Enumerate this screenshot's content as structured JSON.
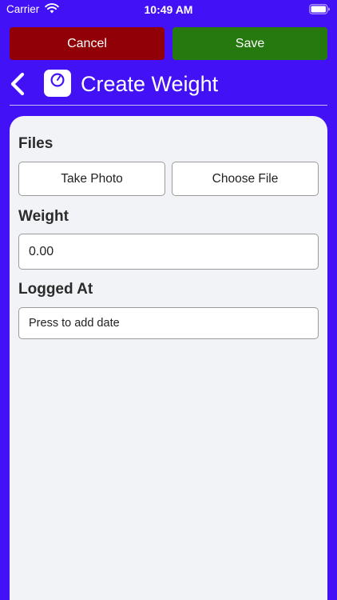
{
  "status_bar": {
    "carrier": "Carrier",
    "time": "10:49 AM",
    "icons": [
      "wifi-icon",
      "battery-icon"
    ]
  },
  "actions": {
    "cancel_label": "Cancel",
    "save_label": "Save"
  },
  "header": {
    "title": "Create Weight",
    "icons": [
      "chevron-left-icon",
      "scale-icon"
    ]
  },
  "form": {
    "files": {
      "label": "Files",
      "take_photo_label": "Take Photo",
      "choose_file_label": "Choose File"
    },
    "weight": {
      "label": "Weight",
      "value": "0.00"
    },
    "logged_at": {
      "label": "Logged At",
      "placeholder": "Press to add date"
    }
  },
  "colors": {
    "background": "#4311f5",
    "cancel": "#910007",
    "save": "#25790f",
    "card": "#f2f3f6"
  }
}
